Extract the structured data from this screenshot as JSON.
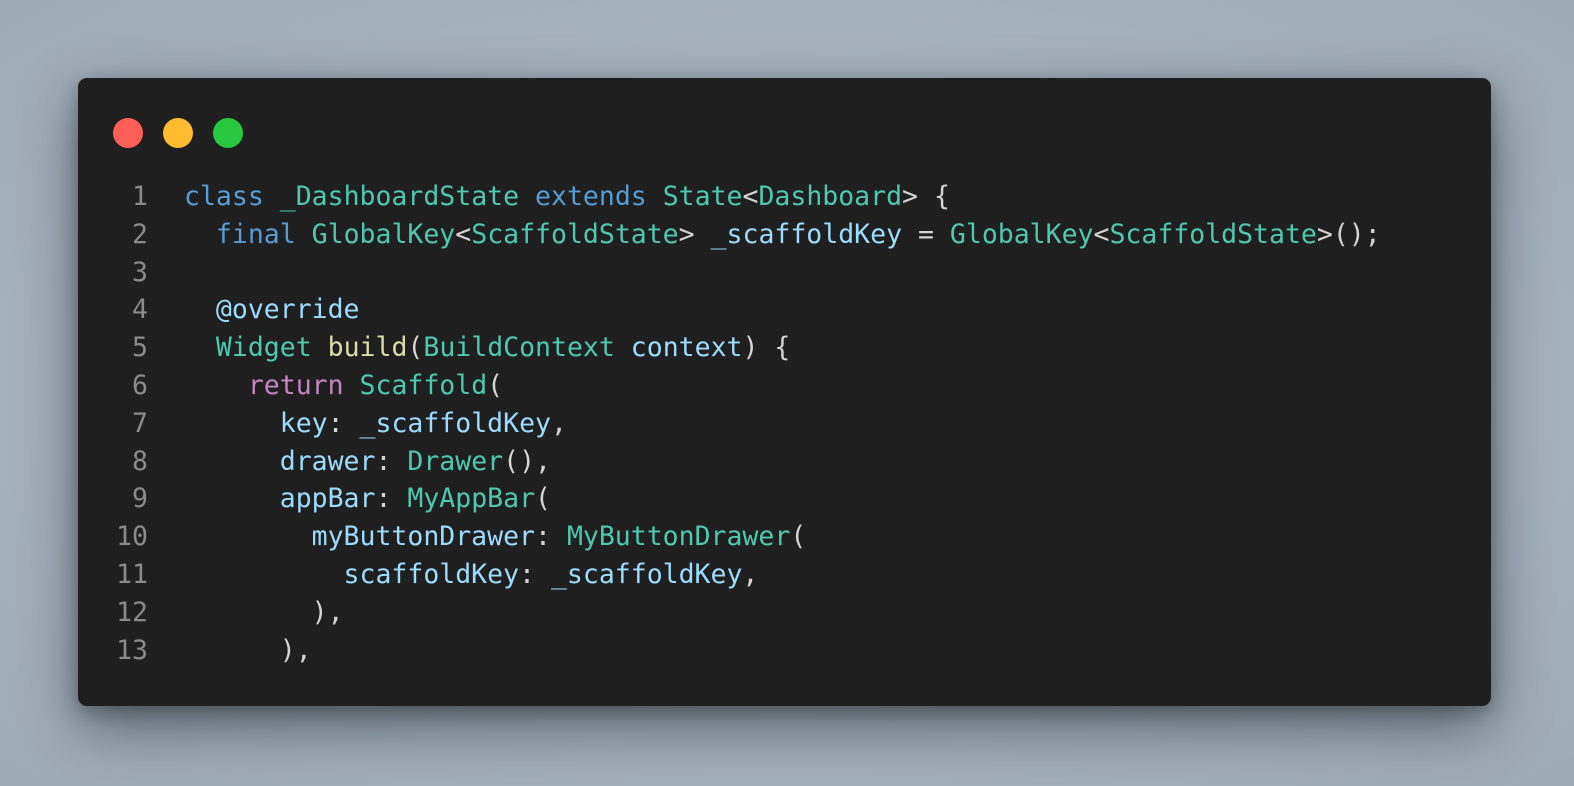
{
  "window": {
    "controls": [
      {
        "name": "close",
        "color": "#ff5f57"
      },
      {
        "name": "minimize",
        "color": "#febc2e"
      },
      {
        "name": "maximize",
        "color": "#28c840"
      }
    ]
  },
  "theme": {
    "background": "#1f1f1f",
    "keyword": "#569cd6",
    "control": "#c586c0",
    "type": "#4ec9b0",
    "function": "#dcdcaa",
    "variable": "#9cdcfe",
    "punct": "#d4d4d4",
    "line_number": "#8b8b8b"
  },
  "code": {
    "lines": [
      {
        "number": "1",
        "tokens": [
          {
            "t": "class",
            "c": "keyword"
          },
          {
            "t": " ",
            "c": "plain"
          },
          {
            "t": "_DashboardState",
            "c": "type"
          },
          {
            "t": " ",
            "c": "plain"
          },
          {
            "t": "extends",
            "c": "keyword"
          },
          {
            "t": " ",
            "c": "plain"
          },
          {
            "t": "State",
            "c": "type"
          },
          {
            "t": "<",
            "c": "punct"
          },
          {
            "t": "Dashboard",
            "c": "type"
          },
          {
            "t": "> {",
            "c": "punct"
          }
        ]
      },
      {
        "number": "2",
        "tokens": [
          {
            "t": "  ",
            "c": "plain"
          },
          {
            "t": "final",
            "c": "keyword"
          },
          {
            "t": " ",
            "c": "plain"
          },
          {
            "t": "GlobalKey",
            "c": "type"
          },
          {
            "t": "<",
            "c": "punct"
          },
          {
            "t": "ScaffoldState",
            "c": "type"
          },
          {
            "t": "> ",
            "c": "punct"
          },
          {
            "t": "_scaffoldKey",
            "c": "variable"
          },
          {
            "t": " = ",
            "c": "punct"
          },
          {
            "t": "GlobalKey",
            "c": "type"
          },
          {
            "t": "<",
            "c": "punct"
          },
          {
            "t": "ScaffoldState",
            "c": "type"
          },
          {
            "t": ">();",
            "c": "punct"
          }
        ]
      },
      {
        "number": "3",
        "tokens": []
      },
      {
        "number": "4",
        "tokens": [
          {
            "t": "  ",
            "c": "plain"
          },
          {
            "t": "@override",
            "c": "variable"
          }
        ]
      },
      {
        "number": "5",
        "tokens": [
          {
            "t": "  ",
            "c": "plain"
          },
          {
            "t": "Widget",
            "c": "type"
          },
          {
            "t": " ",
            "c": "plain"
          },
          {
            "t": "build",
            "c": "function"
          },
          {
            "t": "(",
            "c": "punct"
          },
          {
            "t": "BuildContext",
            "c": "type"
          },
          {
            "t": " ",
            "c": "plain"
          },
          {
            "t": "context",
            "c": "variable"
          },
          {
            "t": ") {",
            "c": "punct"
          }
        ]
      },
      {
        "number": "6",
        "tokens": [
          {
            "t": "    ",
            "c": "plain"
          },
          {
            "t": "return",
            "c": "control"
          },
          {
            "t": " ",
            "c": "plain"
          },
          {
            "t": "Scaffold",
            "c": "type"
          },
          {
            "t": "(",
            "c": "punct"
          }
        ]
      },
      {
        "number": "7",
        "tokens": [
          {
            "t": "      ",
            "c": "plain"
          },
          {
            "t": "key",
            "c": "variable"
          },
          {
            "t": ": ",
            "c": "punct"
          },
          {
            "t": "_scaffoldKey",
            "c": "variable"
          },
          {
            "t": ",",
            "c": "punct"
          }
        ]
      },
      {
        "number": "8",
        "tokens": [
          {
            "t": "      ",
            "c": "plain"
          },
          {
            "t": "drawer",
            "c": "variable"
          },
          {
            "t": ": ",
            "c": "punct"
          },
          {
            "t": "Drawer",
            "c": "type"
          },
          {
            "t": "(),",
            "c": "punct"
          }
        ]
      },
      {
        "number": "9",
        "tokens": [
          {
            "t": "      ",
            "c": "plain"
          },
          {
            "t": "appBar",
            "c": "variable"
          },
          {
            "t": ": ",
            "c": "punct"
          },
          {
            "t": "MyAppBar",
            "c": "type"
          },
          {
            "t": "(",
            "c": "punct"
          }
        ]
      },
      {
        "number": "10",
        "tokens": [
          {
            "t": "        ",
            "c": "plain"
          },
          {
            "t": "myButtonDrawer",
            "c": "variable"
          },
          {
            "t": ": ",
            "c": "punct"
          },
          {
            "t": "MyButtonDrawer",
            "c": "type"
          },
          {
            "t": "(",
            "c": "punct"
          }
        ]
      },
      {
        "number": "11",
        "tokens": [
          {
            "t": "          ",
            "c": "plain"
          },
          {
            "t": "scaffoldKey",
            "c": "variable"
          },
          {
            "t": ": ",
            "c": "punct"
          },
          {
            "t": "_scaffoldKey",
            "c": "variable"
          },
          {
            "t": ",",
            "c": "punct"
          }
        ]
      },
      {
        "number": "12",
        "tokens": [
          {
            "t": "        ",
            "c": "plain"
          },
          {
            "t": "),",
            "c": "punct"
          }
        ]
      },
      {
        "number": "13",
        "tokens": [
          {
            "t": "      ",
            "c": "plain"
          },
          {
            "t": "),",
            "c": "punct"
          }
        ]
      }
    ]
  }
}
